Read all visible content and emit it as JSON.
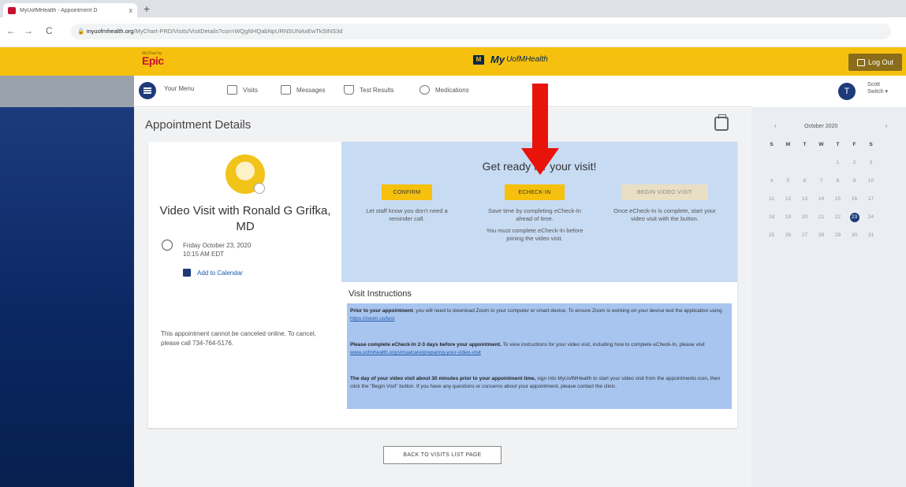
{
  "browser": {
    "tab_title": "MyUofMHealth - Appointment D",
    "tab_close": "x",
    "new_tab": "+",
    "back": "←",
    "forward": "→",
    "reload": "C",
    "url_host": "myuofmhealth.org",
    "url_path": "/MyChart-PRD/Visits/VisitDetails?csn=WQgNHQabNpURNSUNAxEwTkStNS3d"
  },
  "header": {
    "epic_small": "MyChart by",
    "epic": "Epic",
    "brand_box": "M",
    "brand_my": "My",
    "brand_rest": "UofMHealth",
    "logout": "Log Out"
  },
  "nav": {
    "menu": "Your Menu",
    "visits": "Visits",
    "messages": "Messages",
    "test_results": "Test Results",
    "medications": "Medications"
  },
  "user": {
    "initial": "T",
    "name": "Scott",
    "switch": "Switch ▾"
  },
  "page": {
    "title": "Appointment Details"
  },
  "appointment": {
    "title": "Video Visit with Ronald G Grifka, MD",
    "date": "Friday October 23, 2020",
    "time": "10:15 AM EDT",
    "add_to_calendar": "Add to Calendar",
    "cancel_note": "This appointment cannot be canceled online. To cancel, please call 734-764-5176."
  },
  "ready": {
    "heading": "Get ready for your visit!",
    "confirm": "CONFIRM",
    "confirm_desc": "Let staff know you don't need a reminder call.",
    "echeckin": "ECHECK-IN",
    "echeckin_desc": "Save time by completing eCheck-In ahead of time.",
    "echeckin_note": "You must complete eCheck-In before joining the video visit.",
    "begin": "BEGIN VIDEO VISIT",
    "begin_desc": "Once eCheck-In is complete, start your video visit with the button."
  },
  "instructions": {
    "title": "Visit Instructions",
    "p1_bold": "Prior to your appointment",
    "p1": ", you will need to download Zoom to your computer or smart device. To ensure Zoom is working on your device test the application using ",
    "p1_link": "https://zoom.us/test",
    "p2_bold": "Please complete eCheck-In 2-3 days before your appointment.",
    "p2": " To view instructions for your video visit, including how to complete eCheck-In, please visit ",
    "p2_link": "www.uofmhealth.org/virtualcare/preparing-your-video-visit",
    "p3_bold": "The day of your video visit about 30 minutes prior to your appointment time,",
    "p3": " sign into MyUofMHealth to start your video visit from the appointments icon, then click the \"Begin Visit\" button. If you have any questions or concerns about your appointment, please contact the clinic."
  },
  "footer": {
    "back": "BACK TO VISITS LIST PAGE"
  },
  "calendar": {
    "prev": "‹",
    "month": "October 2020",
    "next": "›",
    "dows": [
      "S",
      "M",
      "T",
      "W",
      "T",
      "F",
      "S"
    ],
    "weeks": [
      [
        "",
        "",
        "",
        "",
        "1",
        "2",
        "3"
      ],
      [
        "4",
        "5",
        "6",
        "7",
        "8",
        "9",
        "10"
      ],
      [
        "11",
        "12",
        "13",
        "14",
        "15",
        "16",
        "17"
      ],
      [
        "18",
        "19",
        "20",
        "21",
        "22",
        "23",
        "24"
      ],
      [
        "25",
        "26",
        "27",
        "28",
        "29",
        "30",
        "31"
      ]
    ],
    "selected": "23"
  },
  "colors": {
    "header_yellow": "#f6c10e",
    "navy": "#1f3a7a",
    "annotation_red": "#e8140b",
    "ready_panel": "#c7dbf3",
    "instructions_highlight": "#a8c5f0"
  }
}
